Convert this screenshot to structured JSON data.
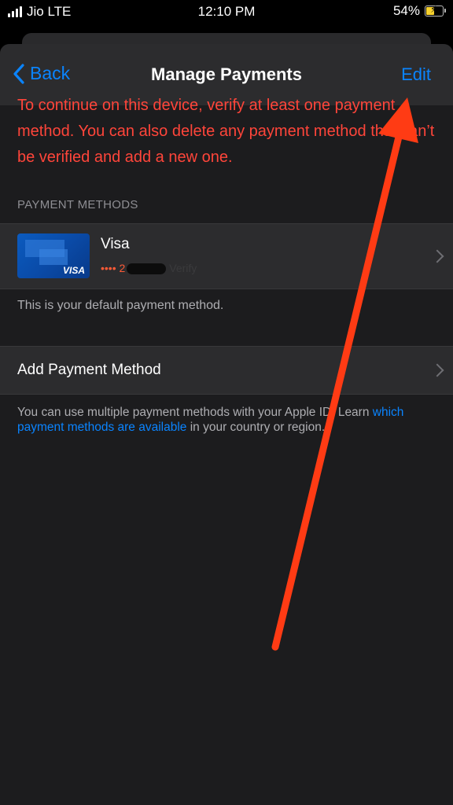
{
  "status_bar": {
    "carrier": "Jio LTE",
    "time": "12:10 PM",
    "battery_percent": "54%",
    "battery_level": 0.54
  },
  "nav": {
    "back_label": "Back",
    "title": "Manage Payments",
    "edit_label": "Edit"
  },
  "warning": "To continue on this device, verify at least one payment method. You can also delete any payment method that can’t be verified and add a new one.",
  "payment_methods": {
    "header": "PAYMENT METHODS",
    "card": {
      "brand_logo": "VISA",
      "name": "Visa",
      "masked_number": "•••• 2",
      "faint_text": "Verify",
      "default_note": "This is your default payment method."
    }
  },
  "add_payment": {
    "label": "Add Payment Method"
  },
  "footer": {
    "text_before": "You can use multiple payment methods with your Apple ID. Learn ",
    "link": "which payment methods are available",
    "text_after": " in your country or region."
  },
  "colors": {
    "accent": "#0a84ff",
    "warning": "#ff453a",
    "annotation_arrow": "#ff3b14"
  }
}
